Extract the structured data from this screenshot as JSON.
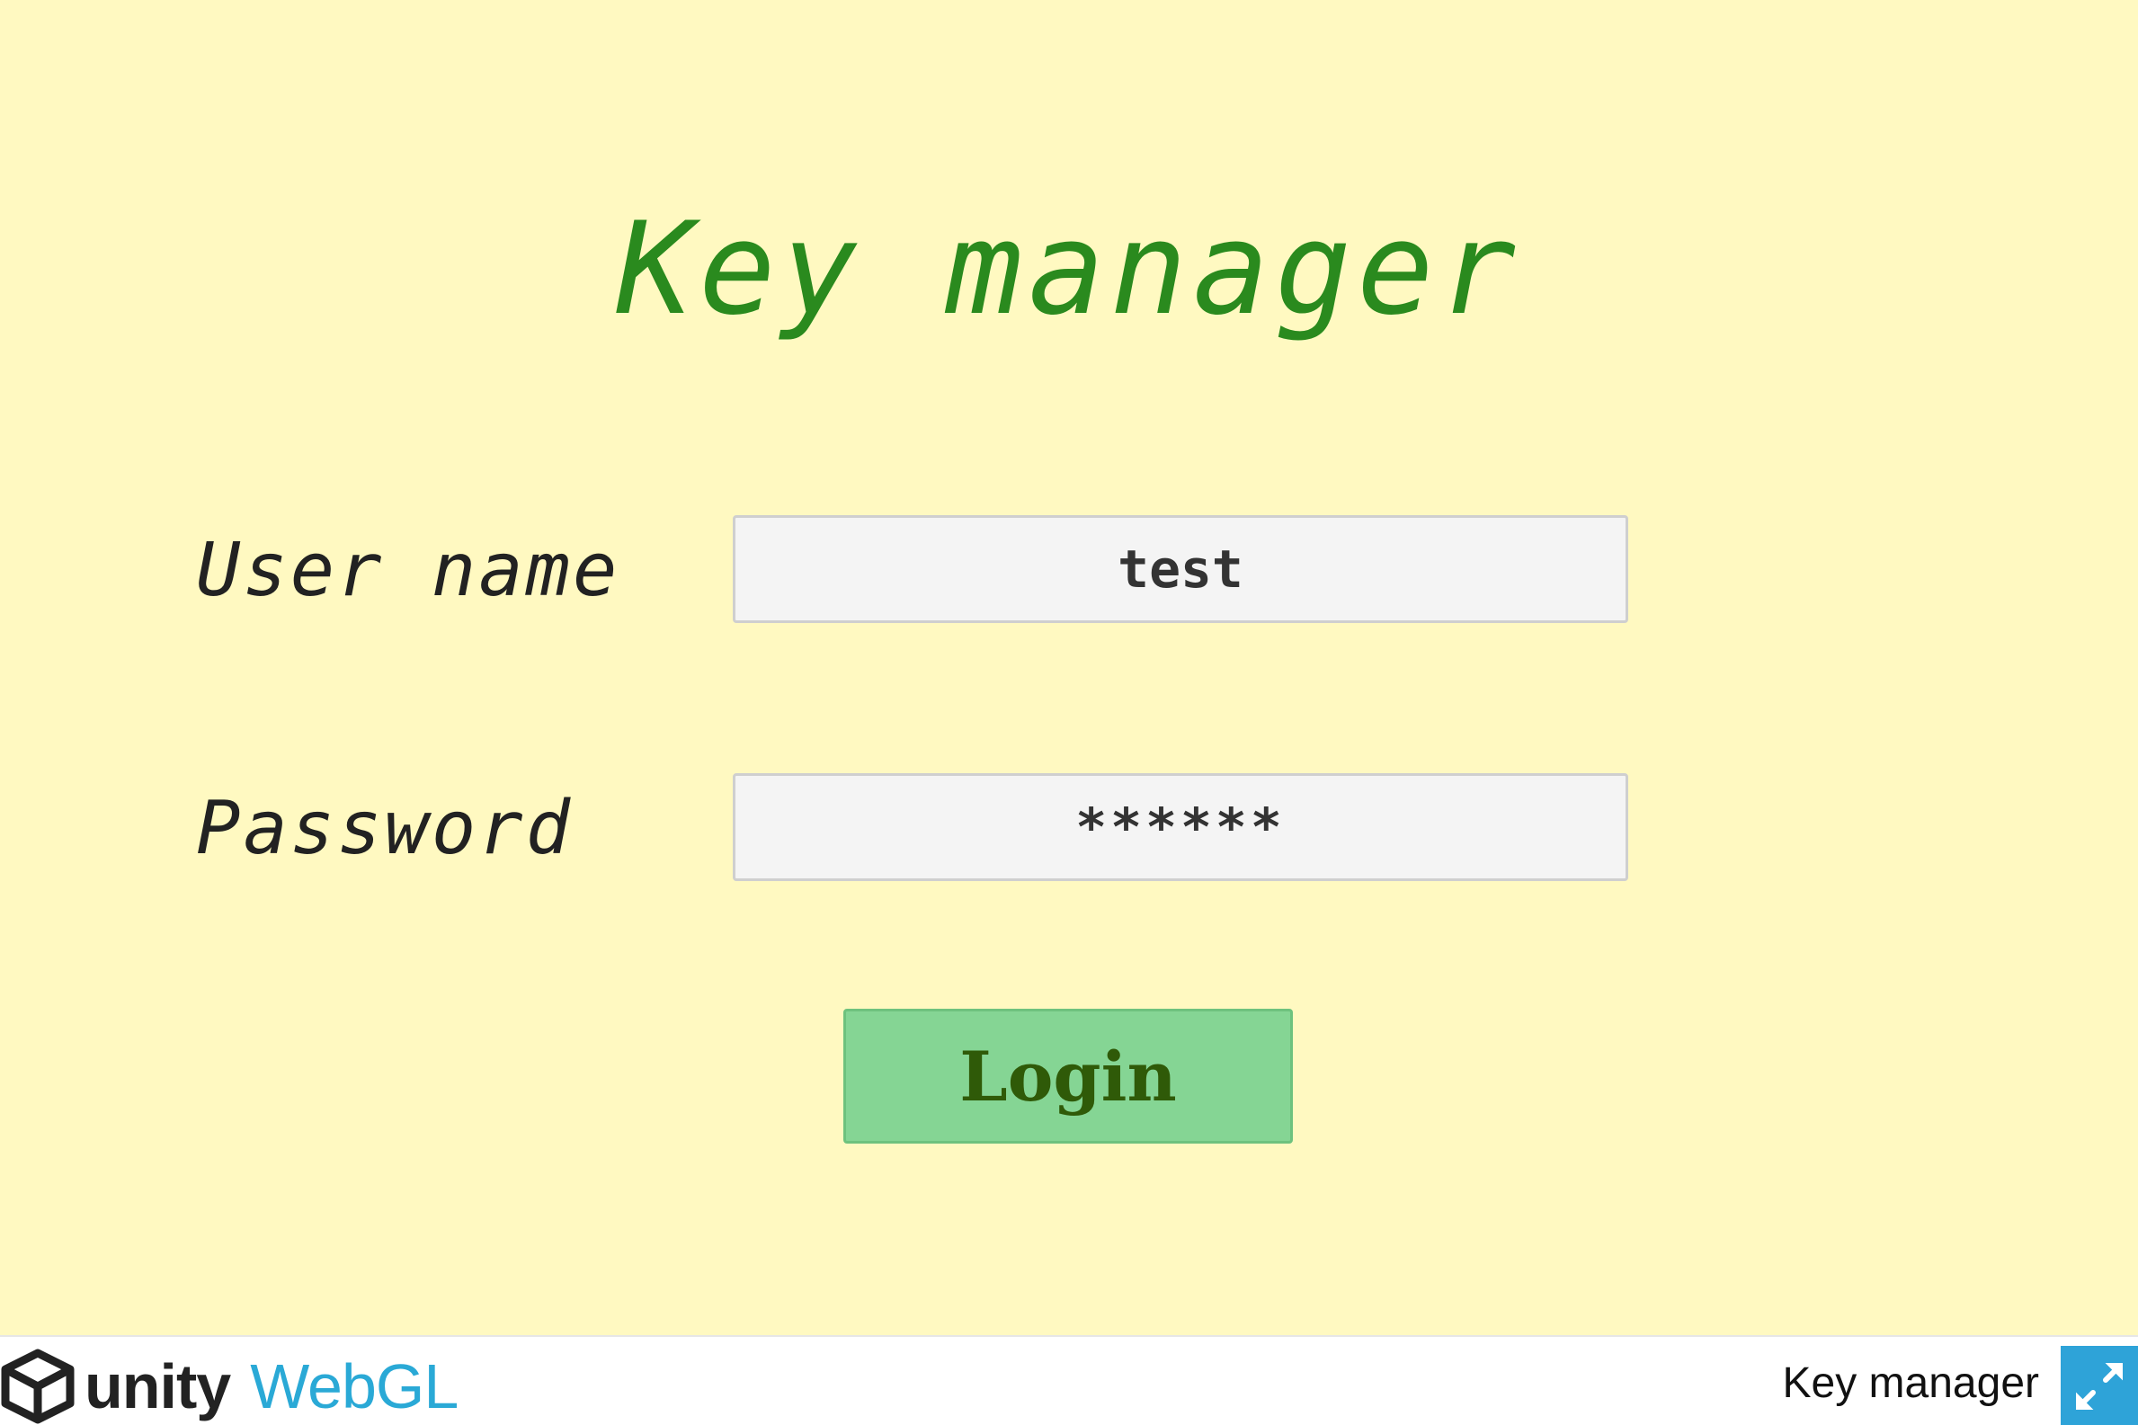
{
  "app": {
    "title": "Key manager"
  },
  "form": {
    "username_label": "User name",
    "username_value": "test",
    "password_label": "Password",
    "password_value": "******",
    "login_label": "Login"
  },
  "footer": {
    "logo_word_unity": "unity",
    "logo_word_webgl": "WebGL",
    "title": "Key manager",
    "fullscreen_icon": "fullscreen-icon"
  },
  "colors": {
    "canvas_background": "#fff9c1",
    "title_color": "#2a8a1e",
    "button_background": "#85d594",
    "button_text": "#2f5a08",
    "webgl_blue": "#2aa9d6",
    "fullscreen_button": "#2ea3d8"
  }
}
